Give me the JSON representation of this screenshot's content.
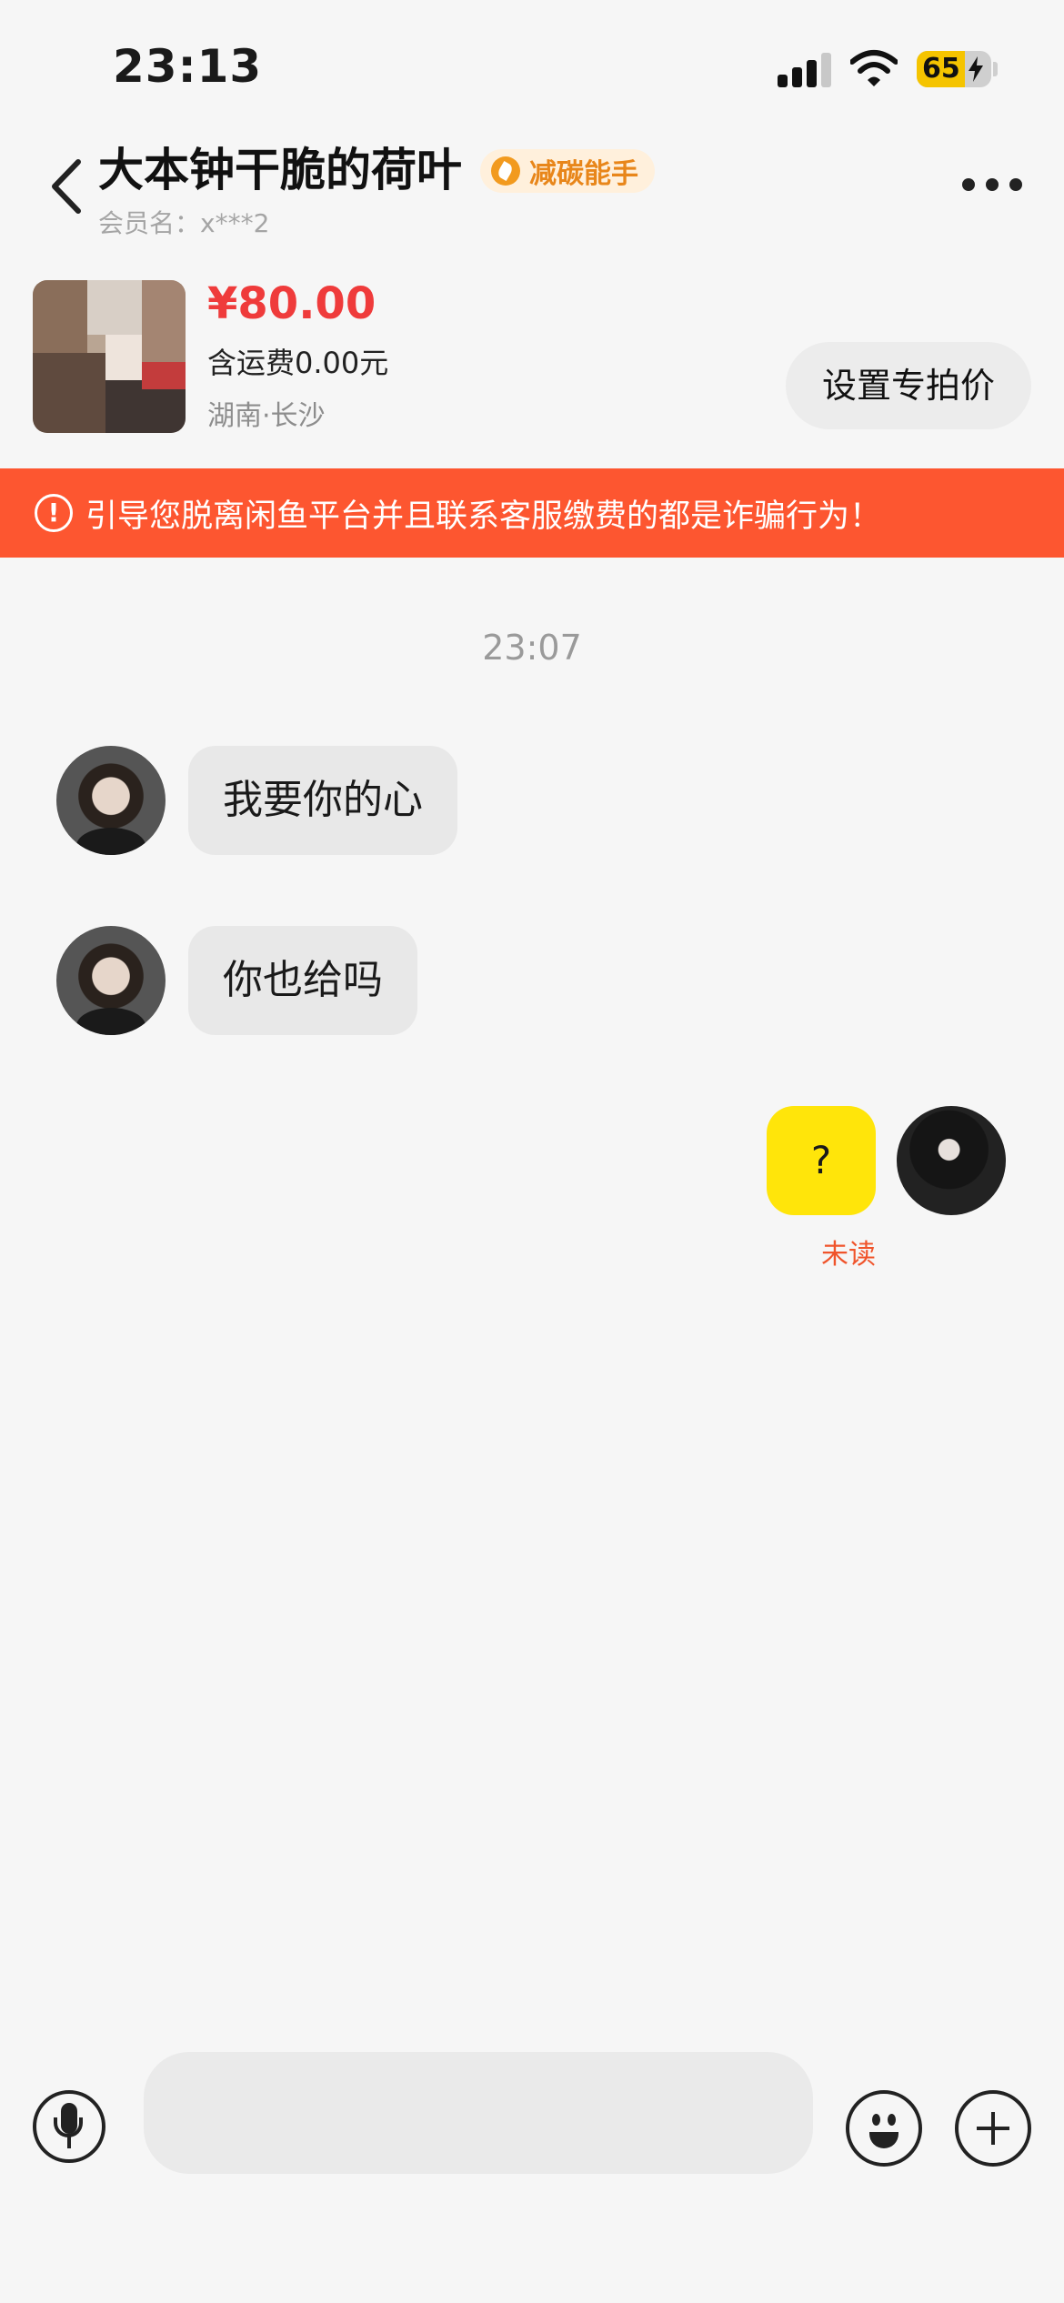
{
  "status_bar": {
    "time": "23:13",
    "battery_level": "65",
    "battery_fraction": 0.65,
    "signal_bars_active": 3,
    "signal_bars_total": 4,
    "icons": [
      "signal-icon",
      "wifi-icon",
      "battery-icon",
      "charging-bolt-icon"
    ]
  },
  "header": {
    "back_icon": "chevron-left-icon",
    "contact_name": "大本钟干脆的荷叶",
    "badge_label": "减碳能手",
    "badge_icon": "leaf-icon",
    "member_label": "会员名：x***2",
    "more_icon": "more-dots-icon"
  },
  "product": {
    "price": "¥80.00",
    "shipping": "含运费0.00元",
    "location": "湖南·长沙",
    "special_price_button": "设置专拍价"
  },
  "warning": {
    "icon": "alert-circle-icon",
    "text": "引导您脱离闲鱼平台并且联系客服缴费的都是诈骗行为！"
  },
  "chat": {
    "timestamp": "23:07",
    "messages": [
      {
        "sender": "other",
        "text": "我要你的心"
      },
      {
        "sender": "other",
        "text": "你也给吗"
      },
      {
        "sender": "self",
        "text": "?",
        "status": "未读"
      }
    ]
  },
  "input_bar": {
    "mic_icon": "microphone-icon",
    "placeholder": "",
    "emoji_icon": "emoji-icon",
    "plus_icon": "plus-circle-icon"
  },
  "colors": {
    "background": "#f6f6f6",
    "price": "#ef3b3b",
    "warning_bar": "#fd5630",
    "self_bubble": "#ffe50a",
    "other_bubble": "#e8e8e8",
    "unread_status": "#f0542b",
    "badge_text": "#e8861a",
    "battery_fill": "#f5c400"
  }
}
